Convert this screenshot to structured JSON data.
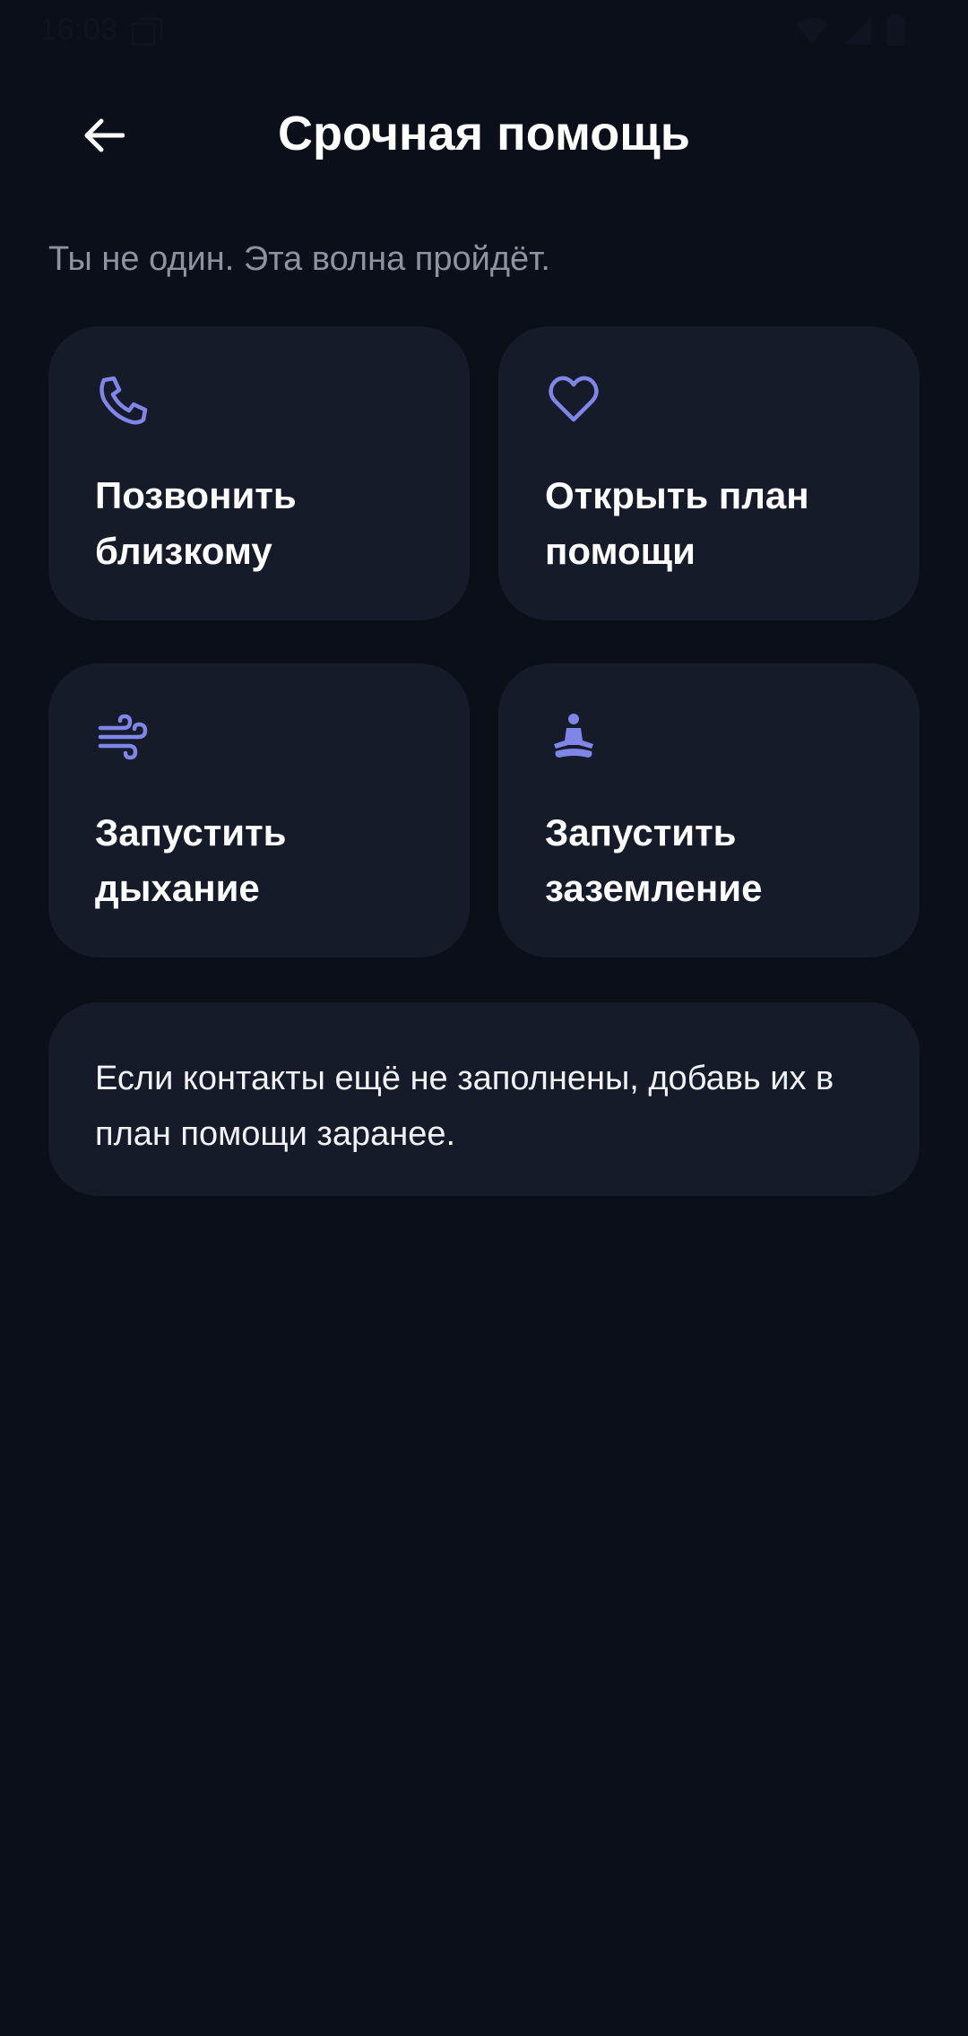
{
  "status_bar": {
    "time": "16:03"
  },
  "header": {
    "title": "Срочная помощь"
  },
  "subtitle": "Ты не один. Эта волна пройдёт.",
  "cards": [
    {
      "label": "Позвонить близкому",
      "icon": "phone-icon"
    },
    {
      "label": "Открыть план помощи",
      "icon": "heart-icon"
    },
    {
      "label": "Запустить дыхание",
      "icon": "wind-icon"
    },
    {
      "label": "Запустить заземление",
      "icon": "meditation-icon"
    }
  ],
  "info": {
    "text": "Если контакты ещё не заполнены, добавь их в план помощи заранее."
  },
  "colors": {
    "background": "#0a0f19",
    "card": "#161b2a",
    "accent": "#7f86e8",
    "muted_text": "#8d93a1"
  }
}
